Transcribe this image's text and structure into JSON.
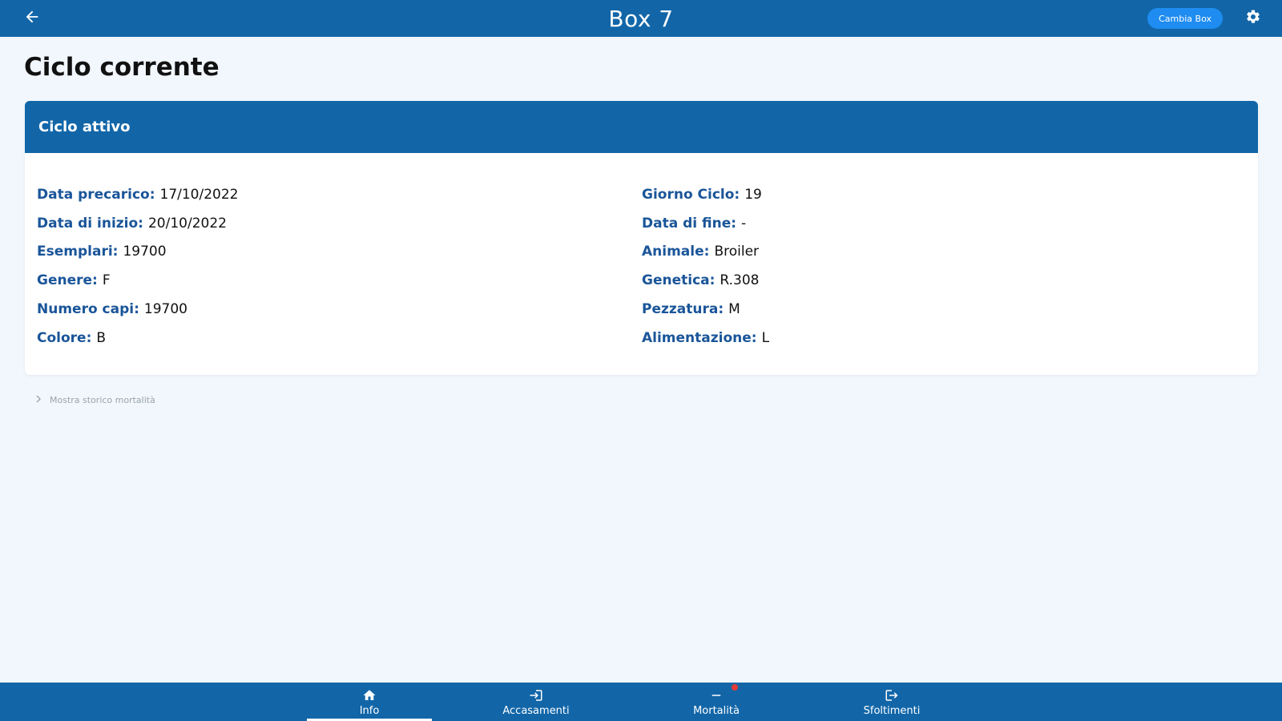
{
  "header": {
    "title": "Box 7",
    "change_box_label": "Cambia Box",
    "back_icon": "arrow-left-icon",
    "settings_icon": "gear-icon"
  },
  "page": {
    "title": "Ciclo corrente"
  },
  "card": {
    "title": "Ciclo attivo",
    "left_fields": [
      {
        "label": "Data precarico:",
        "value": "17/10/2022"
      },
      {
        "label": "Data di inizio:",
        "value": "20/10/2022"
      },
      {
        "label": "Esemplari:",
        "value": "19700"
      },
      {
        "label": "Genere:",
        "value": "F"
      },
      {
        "label": "Numero capi:",
        "value": "19700"
      },
      {
        "label": "Colore:",
        "value": "B"
      }
    ],
    "right_fields": [
      {
        "label": "Giorno Ciclo:",
        "value": "19"
      },
      {
        "label": "Data di fine:",
        "value": "-"
      },
      {
        "label": "Animale:",
        "value": "Broiler"
      },
      {
        "label": "Genetica:",
        "value": "R.308"
      },
      {
        "label": "Pezzatura:",
        "value": "M"
      },
      {
        "label": "Alimentazione:",
        "value": "L"
      }
    ]
  },
  "history_link": {
    "label": "Mostra storico mortalità"
  },
  "bottom_nav": {
    "items": [
      {
        "label": "Info",
        "icon": "home-icon",
        "active": true
      },
      {
        "label": "Accasamenti",
        "icon": "login-icon",
        "active": false
      },
      {
        "label": "Mortalità",
        "icon": "minus-icon",
        "active": false,
        "badge": true
      },
      {
        "label": "Sfoltimenti",
        "icon": "logout-icon",
        "active": false
      }
    ]
  },
  "colors": {
    "primary": "#1266a8",
    "accent_button": "#1e8cf0",
    "label_text": "#1a5599",
    "background": "#f1f7fc",
    "badge": "#e53935"
  }
}
